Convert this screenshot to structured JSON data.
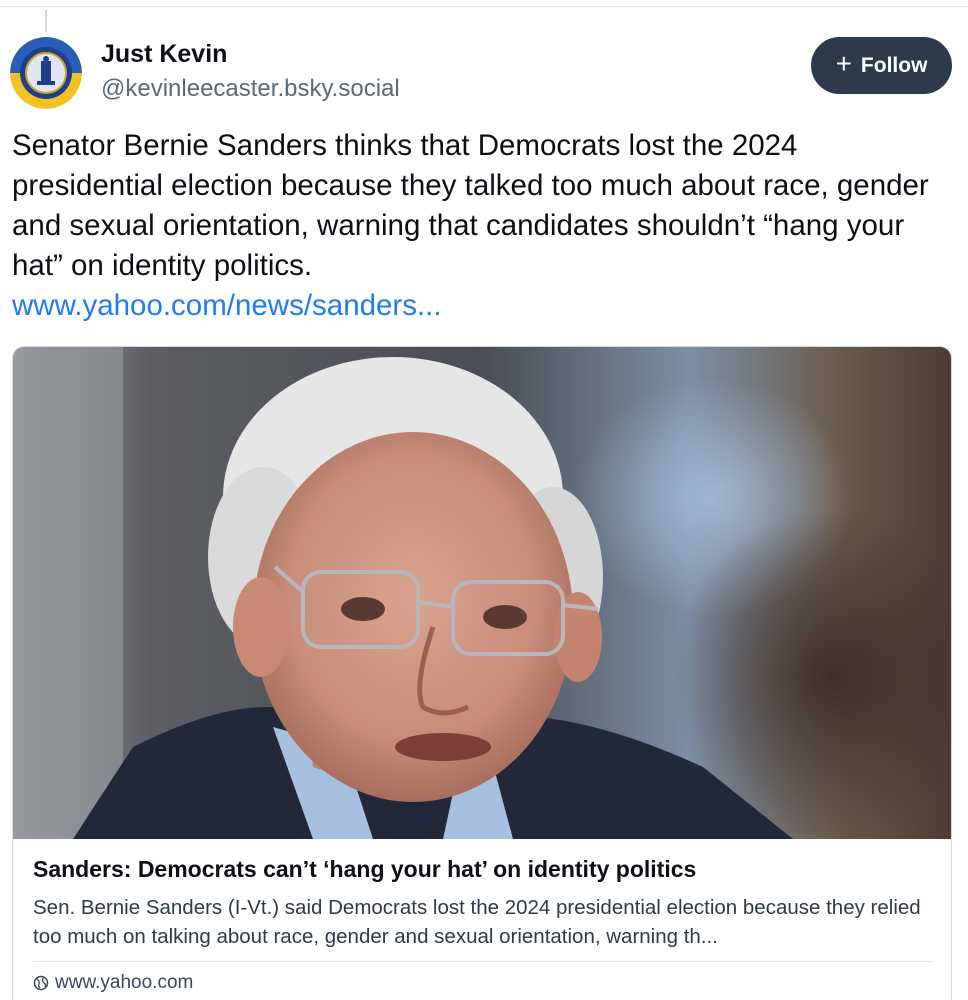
{
  "author": {
    "name": "Just Kevin",
    "handle": "@kevinleecaster.bsky.social"
  },
  "follow_button": {
    "icon": "plus-icon",
    "label": "Follow"
  },
  "post": {
    "text": "Senator Bernie Sanders thinks that Democrats lost the 2024 presidential election because they talked too much about race, gender and sexual orientation, warning that candidates shouldn’t “hang your hat” on identity politics.",
    "link_text": "www.yahoo.com/news/sanders..."
  },
  "link_card": {
    "image_description_icon": "photo",
    "title": "Sanders: Democrats can’t ‘hang your hat’ on identity politics",
    "description": "Sen. Bernie Sanders (I-Vt.) said Democrats lost the 2024 presidential election because they relied too much on talking about race, gender and sexual orientation, warning th...",
    "source_icon": "globe-icon",
    "source": "www.yahoo.com"
  },
  "colors": {
    "link": "#1e7cf2",
    "follow_bg": "#2c3a4b",
    "handle": "#5b6878"
  }
}
